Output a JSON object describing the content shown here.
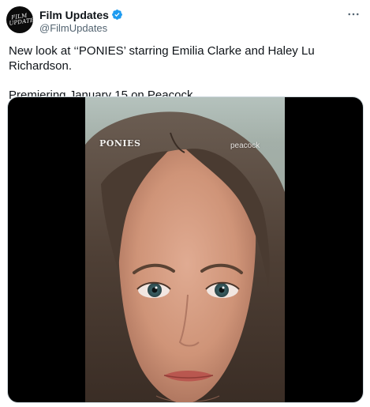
{
  "post": {
    "author": {
      "display_name": "Film Updates",
      "handle": "@FilmUpdates",
      "avatar_text": "FILM UPDATES",
      "verified": true
    },
    "more_icon": "ellipsis-icon",
    "text_line_1": "New look at ‘‘PONIES’ starring Emilia Clarke and Haley Lu Richardson.",
    "text_line_2": "Premiering January 15 on Peacock."
  },
  "media": {
    "watermark_title": "PONIES",
    "watermark_network": "peacock"
  },
  "colors": {
    "verified_badge": "#1d9bf0",
    "text_primary": "#0f1419",
    "text_secondary": "#536471",
    "media_border": "#cfd9de"
  }
}
